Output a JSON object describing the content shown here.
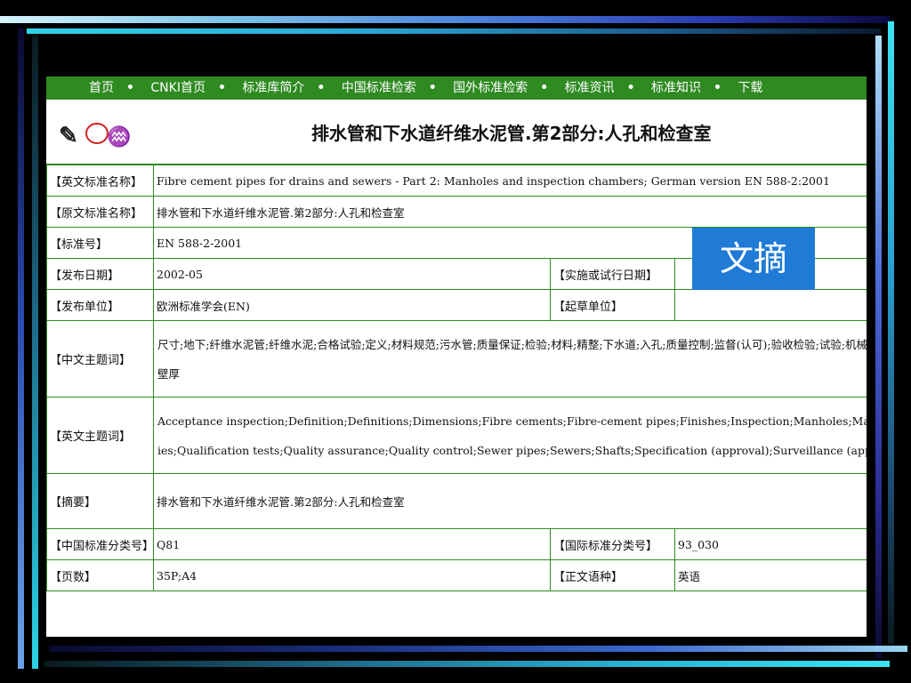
{
  "nav": {
    "items": [
      "首页",
      "CNKI首页",
      "标准库简介",
      "中国标准检索",
      "国外标准检索",
      "标准资讯",
      "标准知识",
      "下载"
    ],
    "separator": "•"
  },
  "title": "排水管和下水道纤维水泥管.第2部分:人孔和检查室",
  "badge": {
    "label": "文摘"
  },
  "fields": {
    "en_name": {
      "label": "【英文标准名称】",
      "value": "Fibre cement pipes for drains and sewers - Part 2: Manholes and inspection chambers; German version EN 588-2:2001"
    },
    "orig_name": {
      "label": "【原文标准名称】",
      "value": "排水管和下水道纤维水泥管.第2部分:人孔和检查室"
    },
    "std_no": {
      "label": "【标准号】",
      "value": "EN 588-2-2001"
    },
    "pub_date": {
      "label": "【发布日期】",
      "value": "2002-05"
    },
    "impl_date": {
      "label": "【实施或试行日期】",
      "value": ""
    },
    "pub_org": {
      "label": "【发布单位】",
      "value": "欧洲标准学会(EN)"
    },
    "draft_org": {
      "label": "【起草单位】",
      "value": ""
    },
    "cn_keywords": {
      "label": "【中文主题词】",
      "line1": "尺寸;地下;纤维水泥管;纤维水泥;合格试验;定义;材料规范;污水管;质量保证;检验;材料;精整;下水道;入孔;质量控制;监督(认可);验收检验;试验;机械",
      "line2": "壁厚"
    },
    "en_keywords": {
      "label": "【英文主题词】",
      "line1": "Acceptance inspection;Definition;Definitions;Dimensions;Fibre cements;Fibre-cement pipes;Finishes;Inspection;Manholes;Materials;Materials specification",
      "line2": "ies;Qualification tests;Quality assurance;Quality control;Sewer pipes;Sewers;Shafts;Specification (approval);Surveillance (approval);Testing;Underground;"
    },
    "abstract": {
      "label": "【摘要】",
      "value": "排水管和下水道纤维水泥管.第2部分:人孔和检查室"
    },
    "cn_class": {
      "label": "【中国标准分类号】",
      "value": "Q81"
    },
    "intl_class": {
      "label": "【国际标准分类号】",
      "value": "93_030"
    },
    "pages": {
      "label": "【页数】",
      "value": "35P;A4"
    },
    "language": {
      "label": "【正文语种】",
      "value": "英语"
    }
  }
}
